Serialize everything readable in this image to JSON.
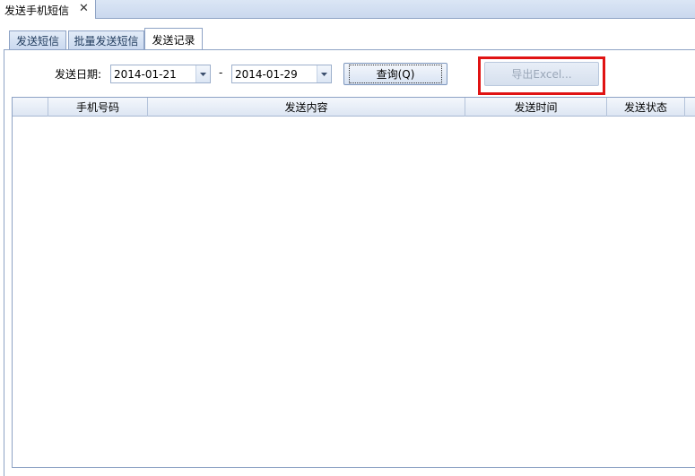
{
  "document_tab": {
    "title": "发送手机短信",
    "close_glyph": "✕"
  },
  "tabs": [
    {
      "label": "发送短信"
    },
    {
      "label": "批量发送短信"
    },
    {
      "label": "发送记录"
    }
  ],
  "filter": {
    "date_label": "发送日期:",
    "date_from": "2014-01-21",
    "separator": "-",
    "date_to": "2014-01-29",
    "query_label": "查询(Q)",
    "export_label": "导出Excel..."
  },
  "grid": {
    "columns": [
      "",
      "手机号码",
      "发送内容",
      "发送时间",
      "发送状态"
    ],
    "rows": []
  },
  "colors": {
    "highlight": "#e01313",
    "accent": "#8ea3c5"
  }
}
